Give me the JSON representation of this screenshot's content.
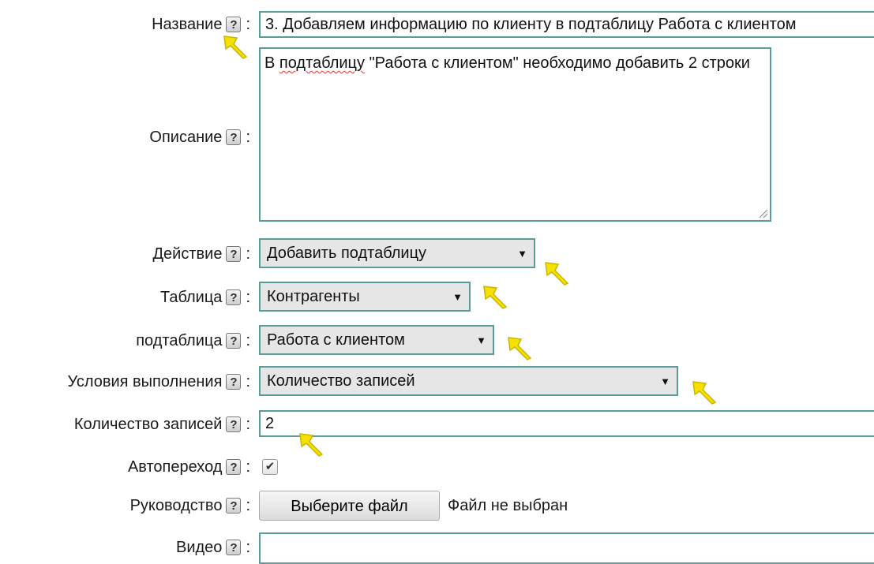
{
  "form": {
    "fields": [
      {
        "label": "Название",
        "help": "?",
        "colon": ":"
      },
      {
        "label": "Описание",
        "help": "?",
        "colon": ":"
      },
      {
        "label": "Действие",
        "help": "?",
        "colon": ":"
      },
      {
        "label": "Таблица",
        "help": "?",
        "colon": ":"
      },
      {
        "label": "подтаблица",
        "help": "?",
        "colon": ":"
      },
      {
        "label": "Условия выполнения",
        "help": "?",
        "colon": ":"
      },
      {
        "label": "Количество записей",
        "help": "?",
        "colon": ":"
      },
      {
        "label": "Автопереход",
        "help": "?",
        "colon": ":"
      },
      {
        "label": "Руководство",
        "help": "?",
        "colon": ":"
      },
      {
        "label": "Видео",
        "help": "?",
        "colon": ":"
      }
    ],
    "name_value": "3. Добавляем информацию по клиенту в подтаблицу Работа с клиентом",
    "description_value_pre": "В ",
    "description_value_marked": "подтаблицу",
    "description_value_post": " \"Работа с клиентом\" необходимо добавить 2 строки",
    "action_selected": "Добавить подтаблицу",
    "table_selected": "Контрагенты",
    "subtable_selected": "Работа с клиентом",
    "condition_selected": "Количество записей",
    "records_count_value": "2",
    "autotransition_checked": true,
    "checkbox_glyph": "✔",
    "file_button_label": "Выберите файл",
    "file_status": "Файл не выбран",
    "video_value": "",
    "dropdown_arrow": "▼"
  },
  "colors": {
    "field_border": "#5d9b9b",
    "select_bg": "#e6e6e6",
    "annotation_arrow": "#f5e100"
  }
}
